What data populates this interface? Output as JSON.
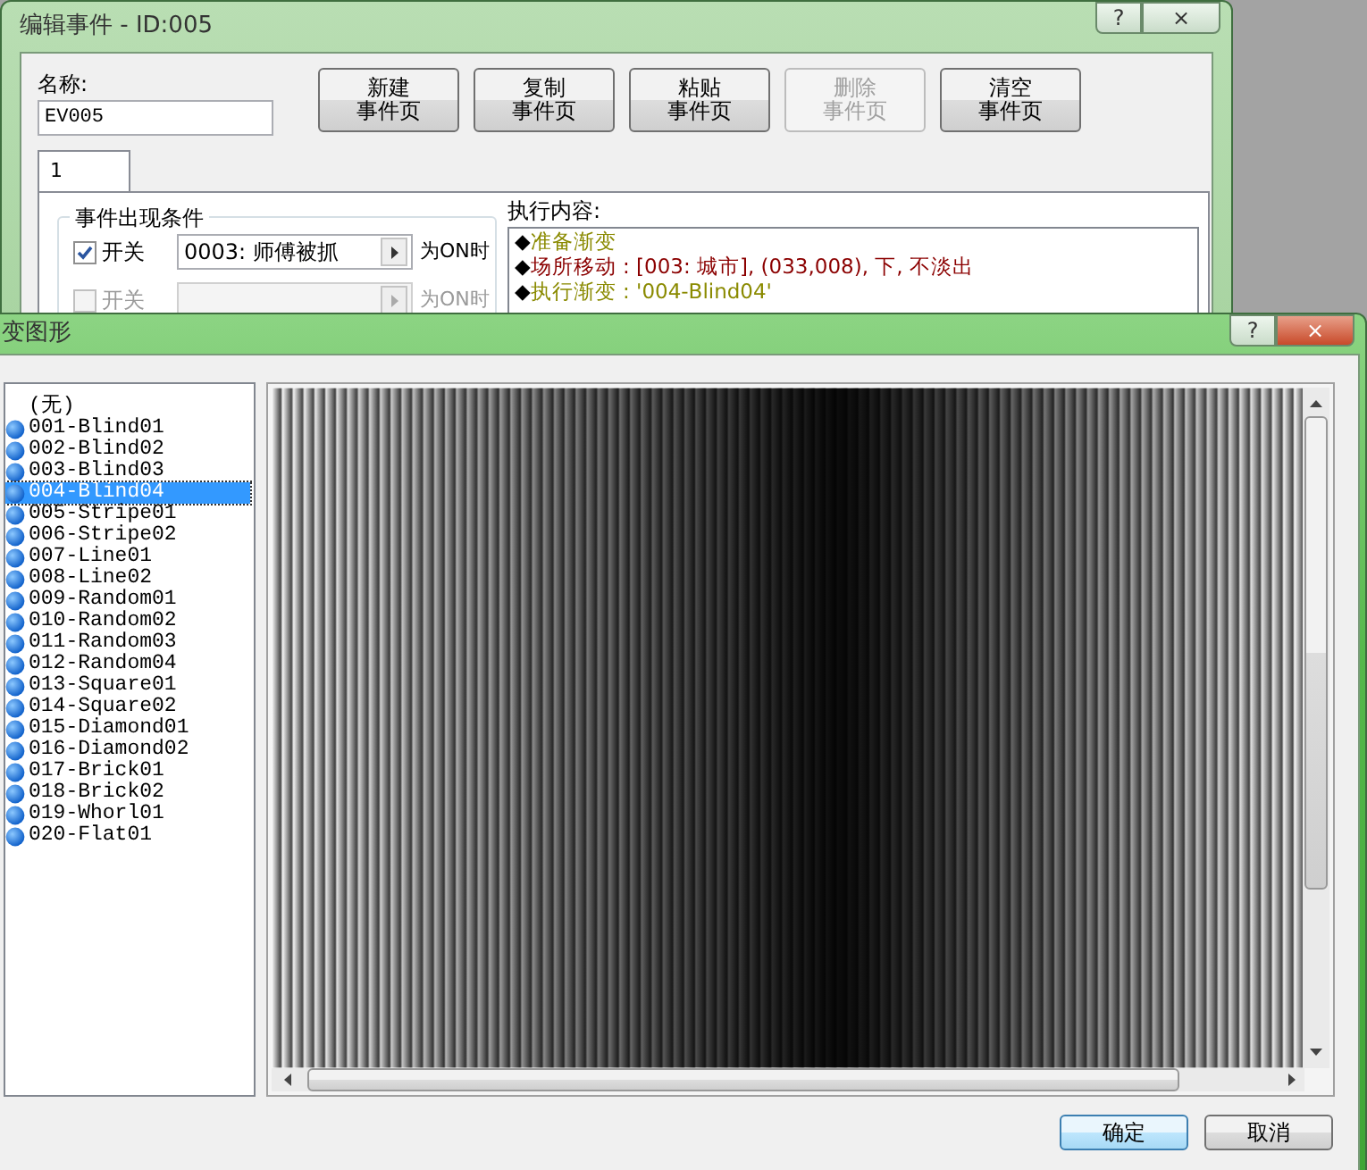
{
  "back_window": {
    "title": "编辑事件 - ID:005",
    "active": false,
    "title_controls": [
      "?",
      "×"
    ],
    "name_label": "名称:",
    "name_value": "EV005",
    "page_buttons": [
      {
        "lines": [
          "新建",
          "事件页"
        ],
        "disabled": false
      },
      {
        "lines": [
          "复制",
          "事件页"
        ],
        "disabled": false
      },
      {
        "lines": [
          "粘贴",
          "事件页"
        ],
        "disabled": false
      },
      {
        "lines": [
          "删除",
          "事件页"
        ],
        "disabled": true
      },
      {
        "lines": [
          "清空",
          "事件页"
        ],
        "disabled": false
      }
    ],
    "tabs": [
      {
        "label": "1",
        "selected": true
      }
    ],
    "conditions": {
      "title": "事件出现条件",
      "rows": [
        {
          "label": "开关",
          "checked": true,
          "disabled": false,
          "value": "0003: 师傅被抓",
          "suffix": "为ON时"
        },
        {
          "label": "开关",
          "checked": false,
          "disabled": true,
          "suffix": "为ON时"
        }
      ]
    },
    "contents": {
      "title": "执行内容:",
      "lines": [
        {
          "marker": "◆",
          "text": "准备渐变",
          "color": "#8a8a00"
        },
        {
          "marker": "◆",
          "text": "场所移动 : [003: 城市], (033,008), 下, 不淡出",
          "color": "#8b0000"
        },
        {
          "marker": "◆",
          "text": "执行渐变 : '004-Blind04'",
          "color": "#8a8a00"
        }
      ]
    }
  },
  "front_window": {
    "title": "变图形",
    "active": true,
    "title_controls": [
      "?",
      "×"
    ],
    "items": [
      {
        "kind": "none",
        "label": "(无)",
        "selected": false
      },
      {
        "kind": "file",
        "label": "001-Blind01",
        "selected": false
      },
      {
        "kind": "file",
        "label": "002-Blind02",
        "selected": false
      },
      {
        "kind": "file",
        "label": "003-Blind03",
        "selected": false
      },
      {
        "kind": "file",
        "label": "004-Blind04",
        "selected": true
      },
      {
        "kind": "file",
        "label": "005-Stripe01",
        "selected": false
      },
      {
        "kind": "file",
        "label": "006-Stripe02",
        "selected": false
      },
      {
        "kind": "file",
        "label": "007-Line01",
        "selected": false
      },
      {
        "kind": "file",
        "label": "008-Line02",
        "selected": false
      },
      {
        "kind": "file",
        "label": "009-Random01",
        "selected": false
      },
      {
        "kind": "file",
        "label": "010-Random02",
        "selected": false
      },
      {
        "kind": "file",
        "label": "011-Random03",
        "selected": false
      },
      {
        "kind": "file",
        "label": "012-Random04",
        "selected": false
      },
      {
        "kind": "file",
        "label": "013-Square01",
        "selected": false
      },
      {
        "kind": "file",
        "label": "014-Square02",
        "selected": false
      },
      {
        "kind": "file",
        "label": "015-Diamond01",
        "selected": false
      },
      {
        "kind": "file",
        "label": "016-Diamond02",
        "selected": false
      },
      {
        "kind": "file",
        "label": "017-Brick01",
        "selected": false
      },
      {
        "kind": "file",
        "label": "018-Brick02",
        "selected": false
      },
      {
        "kind": "file",
        "label": "019-Whorl01",
        "selected": false
      },
      {
        "kind": "file",
        "label": "020-Flat01",
        "selected": false
      }
    ],
    "buttons": [
      {
        "label": "确定",
        "default": true
      },
      {
        "label": "取消",
        "default": false
      }
    ]
  }
}
